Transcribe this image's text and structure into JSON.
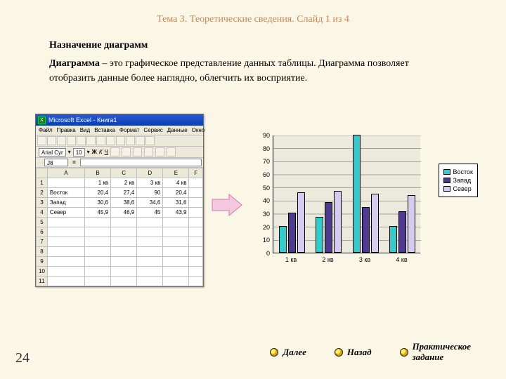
{
  "header": "Тема 3. Теоретические сведения. Слайд 1 из 4",
  "content": {
    "title": "Назначение диаграмм",
    "lead": "Диаграмма",
    "para": " – это графическое представление данных таблицы. Диаграмма позволяет отобразить данные более наглядно,  облегчить их восприятие."
  },
  "excel": {
    "title": "Microsoft Excel - Книга1",
    "menus": [
      "Файл",
      "Правка",
      "Вид",
      "Вставка",
      "Формат",
      "Сервис",
      "Данные",
      "Окно"
    ],
    "font": "Arial Cyr",
    "size": "10",
    "namebox": "J8",
    "cols": [
      "",
      "A",
      "B",
      "C",
      "D",
      "E",
      "F"
    ],
    "rows": [
      {
        "n": "1",
        "cells": [
          "",
          "1 кв",
          "2 кв",
          "3 кв",
          "4 кв",
          ""
        ]
      },
      {
        "n": "2",
        "cells": [
          "Восток",
          "20,4",
          "27,4",
          "90",
          "20,4",
          ""
        ]
      },
      {
        "n": "3",
        "cells": [
          "Запад",
          "30,6",
          "38,6",
          "34,6",
          "31,6",
          ""
        ]
      },
      {
        "n": "4",
        "cells": [
          "Север",
          "45,9",
          "46,9",
          "45",
          "43,9",
          ""
        ]
      },
      {
        "n": "5",
        "cells": [
          "",
          "",
          "",
          "",
          "",
          ""
        ]
      },
      {
        "n": "6",
        "cells": [
          "",
          "",
          "",
          "",
          "",
          ""
        ]
      },
      {
        "n": "7",
        "cells": [
          "",
          "",
          "",
          "",
          "",
          ""
        ]
      },
      {
        "n": "8",
        "cells": [
          "",
          "",
          "",
          "",
          "",
          ""
        ]
      },
      {
        "n": "9",
        "cells": [
          "",
          "",
          "",
          "",
          "",
          ""
        ]
      },
      {
        "n": "10",
        "cells": [
          "",
          "",
          "",
          "",
          "",
          ""
        ]
      },
      {
        "n": "11",
        "cells": [
          "",
          "",
          "",
          "",
          "",
          ""
        ]
      }
    ]
  },
  "chart_data": {
    "type": "bar",
    "categories": [
      "1 кв",
      "2 кв",
      "3 кв",
      "4 кв"
    ],
    "series": [
      {
        "name": "Восток",
        "values": [
          20.4,
          27.4,
          90,
          20.4
        ]
      },
      {
        "name": "Запад",
        "values": [
          30.6,
          38.6,
          34.6,
          31.6
        ]
      },
      {
        "name": "Север",
        "values": [
          45.9,
          46.9,
          45,
          43.9
        ]
      }
    ],
    "ylim": [
      0,
      90
    ],
    "yticks": [
      0,
      10,
      20,
      30,
      40,
      50,
      60,
      70,
      80,
      90
    ],
    "xlabel": "",
    "ylabel": "",
    "title": ""
  },
  "nav": {
    "next": "Далее",
    "back": "Назад",
    "task_l1": "Практическое",
    "task_l2": "задание"
  },
  "page": "24"
}
